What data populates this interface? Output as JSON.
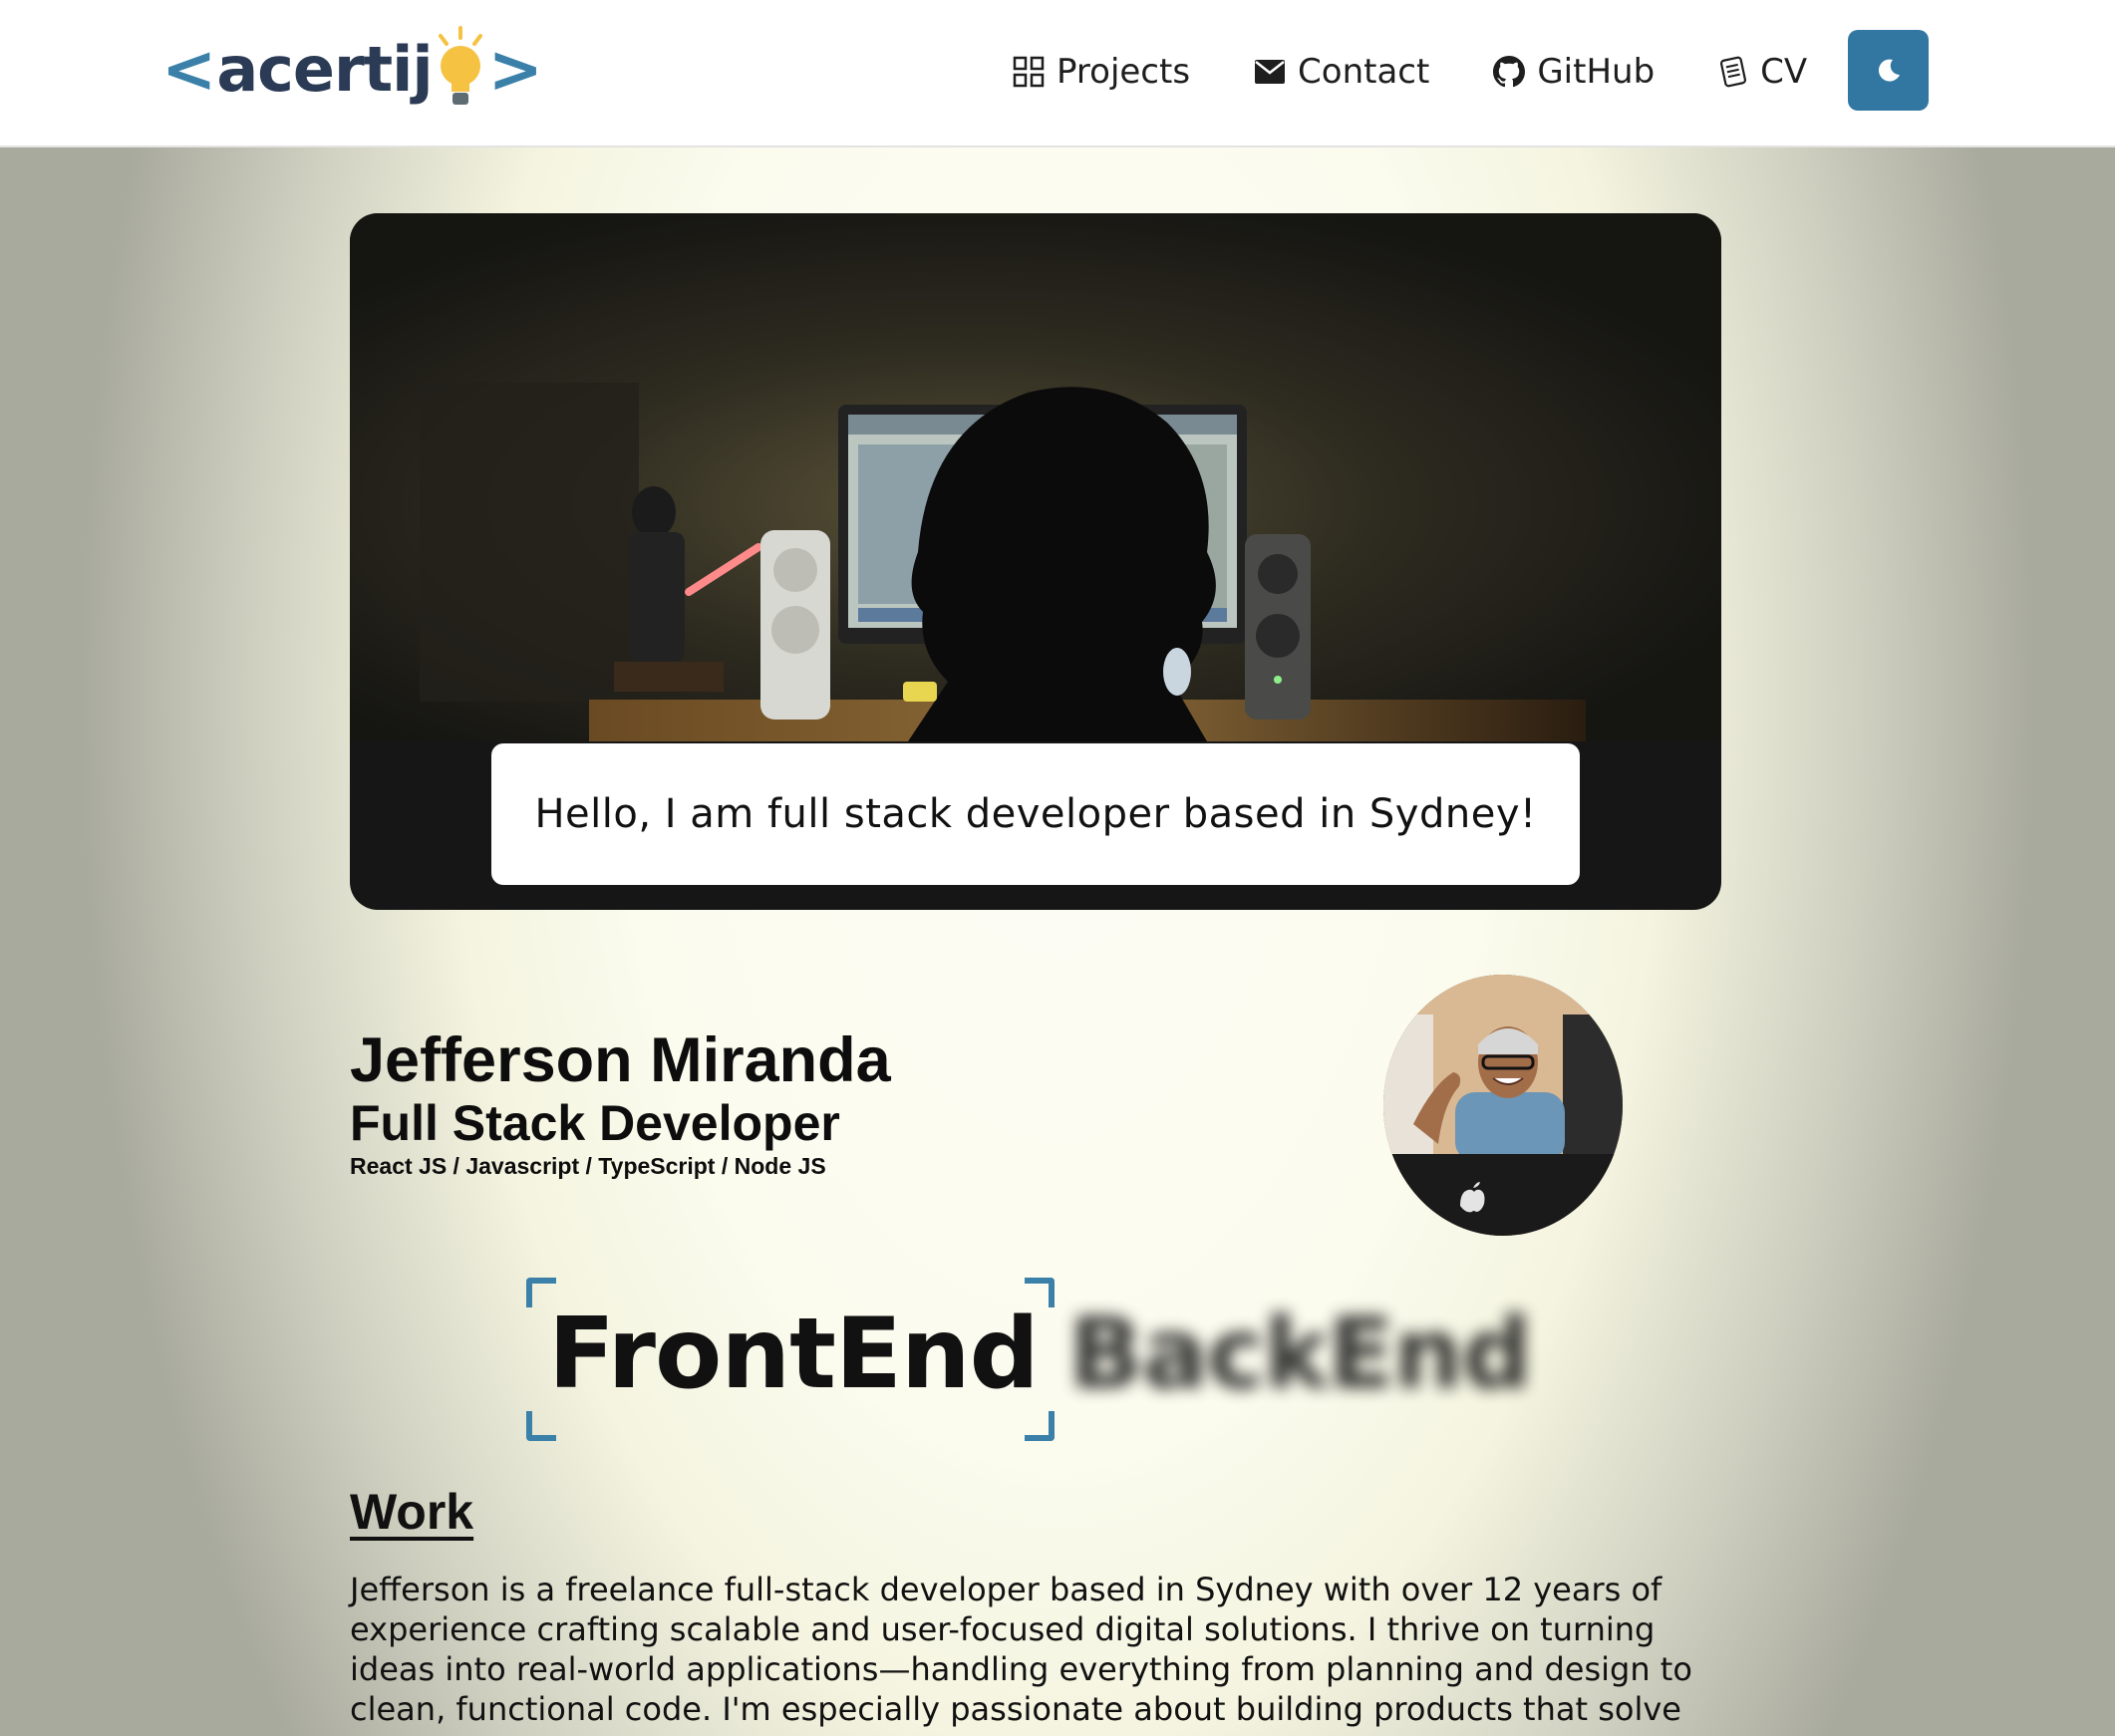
{
  "nav": {
    "logo": {
      "left": "<",
      "text": "acertij",
      "right": ">"
    },
    "links": [
      {
        "label": "Projects",
        "icon": "grid-icon"
      },
      {
        "label": "Contact",
        "icon": "mail-icon"
      },
      {
        "label": "GitHub",
        "icon": "github-icon"
      },
      {
        "label": "CV",
        "icon": "document-icon"
      }
    ],
    "theme_toggle_icon": "moon-icon"
  },
  "hero": {
    "greeting": "Hello, I am full stack developer based in Sydney!"
  },
  "profile": {
    "name": "Jefferson Miranda",
    "role": "Full Stack Developer",
    "stack": "React JS / Javascript / TypeScript / Node JS"
  },
  "flip_words": {
    "active": "FrontEnd",
    "next": "BackEnd"
  },
  "work": {
    "title": "Work",
    "text": "Jefferson is a freelance full-stack developer based in Sydney with over 12 years of experience crafting scalable and user-focused digital solutions. I thrive on turning ideas into real-world applications—handling everything from planning and design to clean, functional code. I'm especially passionate about building products that solve"
  },
  "colors": {
    "accent": "#3277a2",
    "logo_dark": "#2b3a55",
    "bulb": "#f5c242"
  }
}
